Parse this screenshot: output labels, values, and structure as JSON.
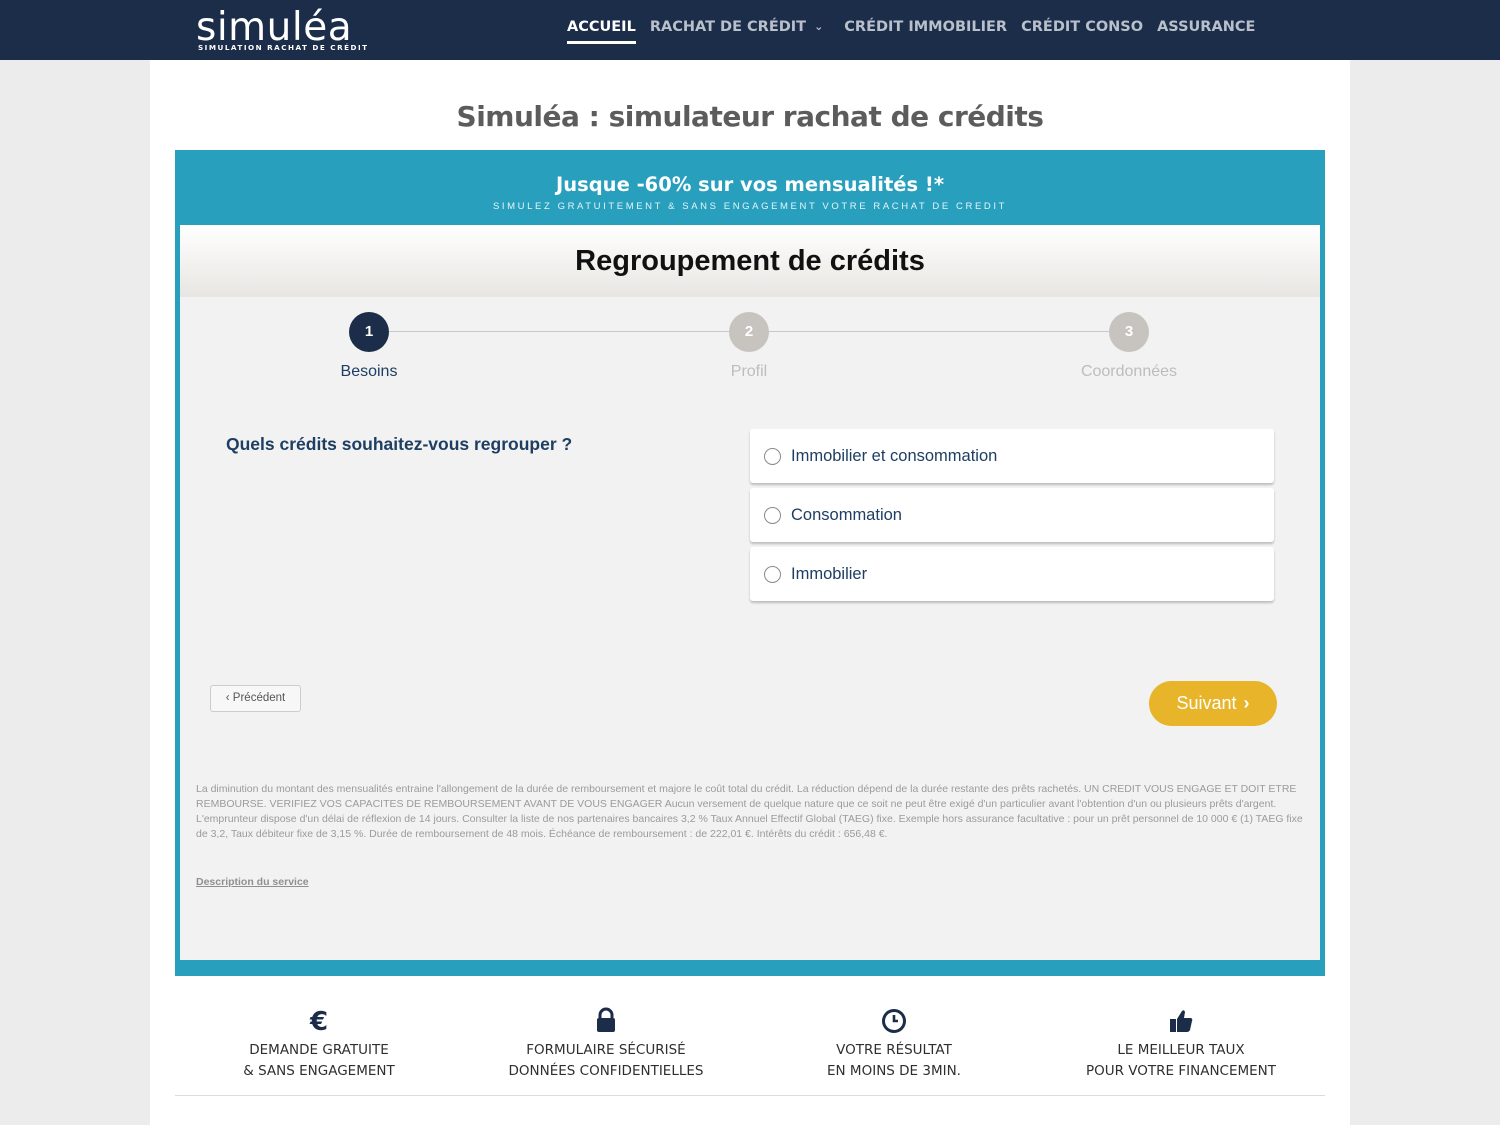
{
  "header": {
    "logo_text": "simuléa",
    "logo_tagline": "SIMULATION RACHAT DE CRÉDIT",
    "nav": [
      {
        "label": "ACCUEIL"
      },
      {
        "label": "RACHAT DE CRÉDIT"
      },
      {
        "label": "CRÉDIT IMMOBILIER"
      },
      {
        "label": "CRÉDIT CONSO"
      },
      {
        "label": "ASSURANCE"
      }
    ]
  },
  "page": {
    "title": "Simuléa : simulateur rachat de crédits"
  },
  "promo": {
    "title": "Jusque -60% sur vos mensualités !*",
    "subtitle": "SIMULEZ GRATUITEMENT & SANS ENGAGEMENT VOTRE RACHAT DE CREDIT"
  },
  "form": {
    "title": "Regroupement de crédits",
    "steps": [
      {
        "number": "1",
        "label": "Besoins"
      },
      {
        "number": "2",
        "label": "Profil"
      },
      {
        "number": "3",
        "label": "Coordonnées"
      }
    ],
    "current_step": 1,
    "question": "Quels crédits souhaitez-vous regrouper ?",
    "options": [
      {
        "label": "Immobilier et consommation"
      },
      {
        "label": "Consommation"
      },
      {
        "label": "Immobilier"
      }
    ],
    "prev_label": "Précédent",
    "next_label": "Suivant",
    "legal": "La diminution du montant des mensualités entraine l'allongement de la durée de remboursement et majore le coût total du crédit. La réduction dépend de la durée restante des prêts rachetés. UN CREDIT VOUS ENGAGE ET DOIT ETRE REMBOURSE. VERIFIEZ VOS CAPACITES DE REMBOURSEMENT AVANT DE VOUS ENGAGER Aucun versement de quelque nature que ce soit ne peut être exigé d'un particulier avant l'obtention d'un ou plusieurs prêts d'argent. L'emprunteur dispose d'un délai de réflexion de 14 jours. Consulter la liste de nos partenaires bancaires 3,2 % Taux Annuel Effectif Global (TAEG) fixe. Exemple hors assurance facultative : pour un prêt personnel de 10 000 € (1) TAEG fixe de 3,2, Taux débiteur fixe de 3,15 %. Durée de remboursement de 48 mois. Échéance de remboursement : de 222,01 €. Intérêts du crédit : 656,48 €.",
    "description_link": "Description du service"
  },
  "features": [
    {
      "icon": "euro-icon",
      "line1": "DEMANDE GRATUITE",
      "line2": "& SANS ENGAGEMENT"
    },
    {
      "icon": "lock-icon",
      "line1": "FORMULAIRE SÉCURISÉ",
      "line2": "DONNÉES CONFIDENTIELLES"
    },
    {
      "icon": "clock-icon",
      "line1": "VOTRE RÉSULTAT",
      "line2": "EN MOINS DE 3MIN."
    },
    {
      "icon": "thumbs-up-icon",
      "line1": "LE MEILLEUR TAUX",
      "line2": "POUR VOTRE FINANCEMENT"
    }
  ],
  "colors": {
    "navbar": "#1b2d48",
    "frame": "#289fbd",
    "primary_text": "#1e3e62",
    "next_button": "#e7b42a"
  }
}
